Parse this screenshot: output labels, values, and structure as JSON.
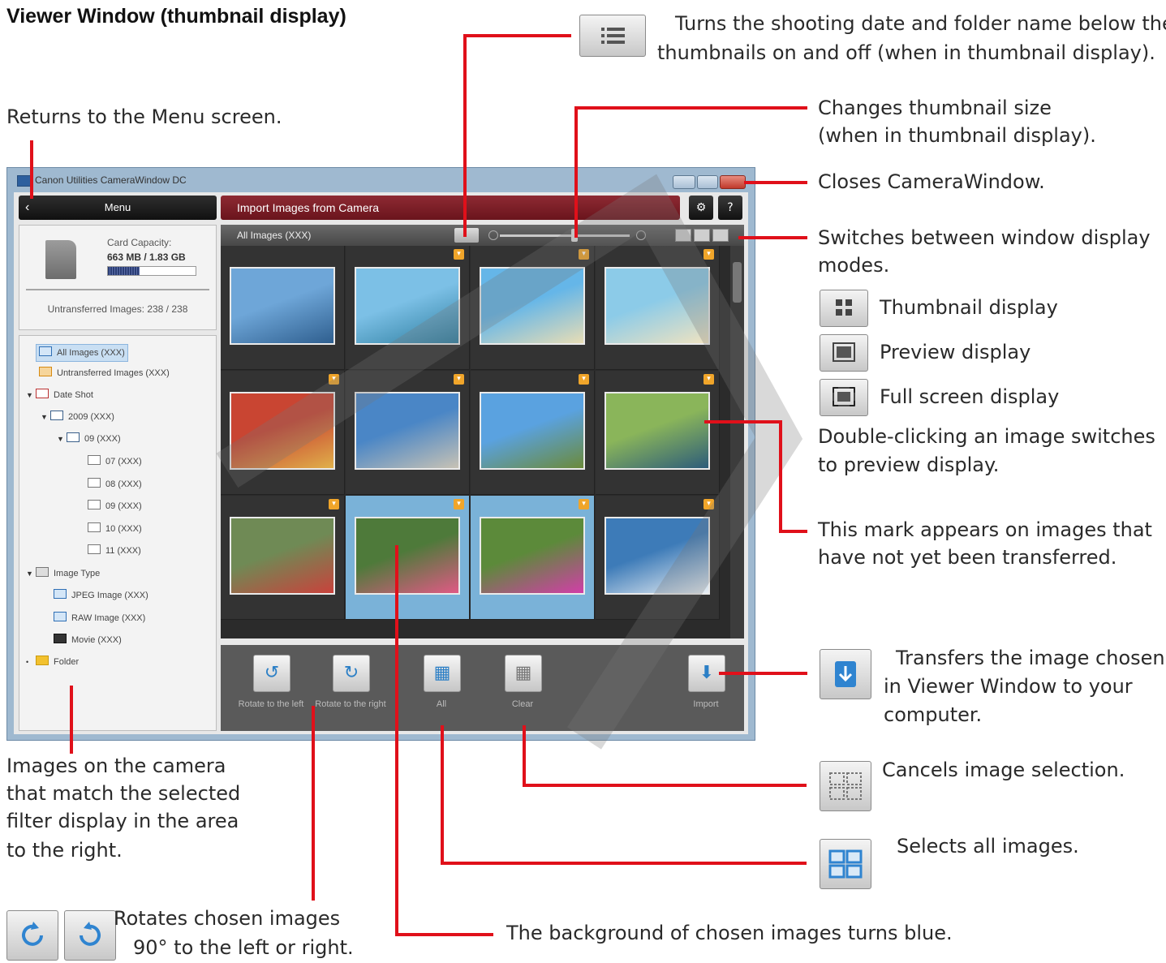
{
  "heading": "Viewer Window (thumbnail display)",
  "window": {
    "title": "Canon Utilities CameraWindow DC",
    "menu_label": "Menu",
    "import_header": "Import Images from Camera",
    "settings_icon": "gear-icon",
    "help_label": "?",
    "card": {
      "capacity_label": "Card Capacity:",
      "capacity_value": "663 MB / 1.83 GB",
      "capacity_used_fraction": 0.36,
      "untransferred": "Untransferred Images: 238 / 238"
    },
    "tree": [
      {
        "label": "All Images (XXX)",
        "selected": true
      },
      {
        "label": "Untransferred Images (XXX)"
      },
      {
        "label": "Date Shot"
      },
      {
        "label": "2009 (XXX)"
      },
      {
        "label": "09 (XXX)"
      },
      {
        "label": "07 (XXX)"
      },
      {
        "label": "08 (XXX)"
      },
      {
        "label": "09 (XXX)"
      },
      {
        "label": "10 (XXX)"
      },
      {
        "label": "11 (XXX)"
      },
      {
        "label": "Image Type"
      },
      {
        "label": "JPEG Image (XXX)"
      },
      {
        "label": "RAW Image (XXX)"
      },
      {
        "label": "Movie (XXX)"
      },
      {
        "label": "Folder"
      }
    ],
    "viewer_label": "All Images (XXX)",
    "thumbnails": [
      {
        "scene": "birds over sea",
        "chosen": false
      },
      {
        "scene": "boat at pier",
        "chosen": false
      },
      {
        "scene": "tropical beach",
        "chosen": false
      },
      {
        "scene": "beach umbrella",
        "chosen": false
      },
      {
        "scene": "toy airplane",
        "chosen": false
      },
      {
        "scene": "building",
        "chosen": false
      },
      {
        "scene": "hut with palm",
        "chosen": false
      },
      {
        "scene": "cyclists",
        "chosen": false
      },
      {
        "scene": "red plant",
        "chosen": false
      },
      {
        "scene": "pink flower",
        "chosen": true
      },
      {
        "scene": "cosmos flower",
        "chosen": true
      },
      {
        "scene": "seagull",
        "chosen": false
      }
    ],
    "toolbar": {
      "rotate_left": "Rotate to the left",
      "rotate_right": "Rotate to the right",
      "all": "All",
      "clear": "Clear",
      "import": "Import"
    }
  },
  "annotations": {
    "display_toggle": "Turns the shooting date and folder name below the thumbnails on and off (when in thumbnail display).",
    "display_toggle_l1": "Turns the shooting date and folder name below the",
    "display_toggle_l2": "thumbnails on and off (when in thumbnail display).",
    "menu_return": "Returns to the Menu screen.",
    "thumb_size_l1": "Changes thumbnail size",
    "thumb_size_l2": "(when in thumbnail display).",
    "close": "Closes CameraWindow.",
    "modes_l1": "Switches between window display",
    "modes_l2": "modes.",
    "mode_thumbnail": "Thumbnail display",
    "mode_preview": "Preview display",
    "mode_fullscreen": "Full screen display",
    "dblclick_l1": "Double-clicking an image switches",
    "dblclick_l2": "to preview display.",
    "mark_l1": "This mark appears on images that",
    "mark_l2": "have not yet been transferred.",
    "transfer_l1": "Transfers the image chosen",
    "transfer_l2": "in Viewer Window to your",
    "transfer_l3": "computer.",
    "cancel_sel": "Cancels image selection.",
    "select_all": "Selects all images.",
    "filter_l1": "Images on the camera",
    "filter_l2": "that match the selected",
    "filter_l3": "filter display in the area",
    "filter_l4": "to the right.",
    "rotate_l1": "Rotates chosen images",
    "rotate_l2": "90° to the left or right.",
    "chosen_blue": "The background of chosen images turns blue."
  },
  "colors": {
    "callout_line": "#e0101a",
    "chosen_bg": "#7ab2d8",
    "import_header": "#7a1e26",
    "unsent_mark": "#f0a52a"
  }
}
